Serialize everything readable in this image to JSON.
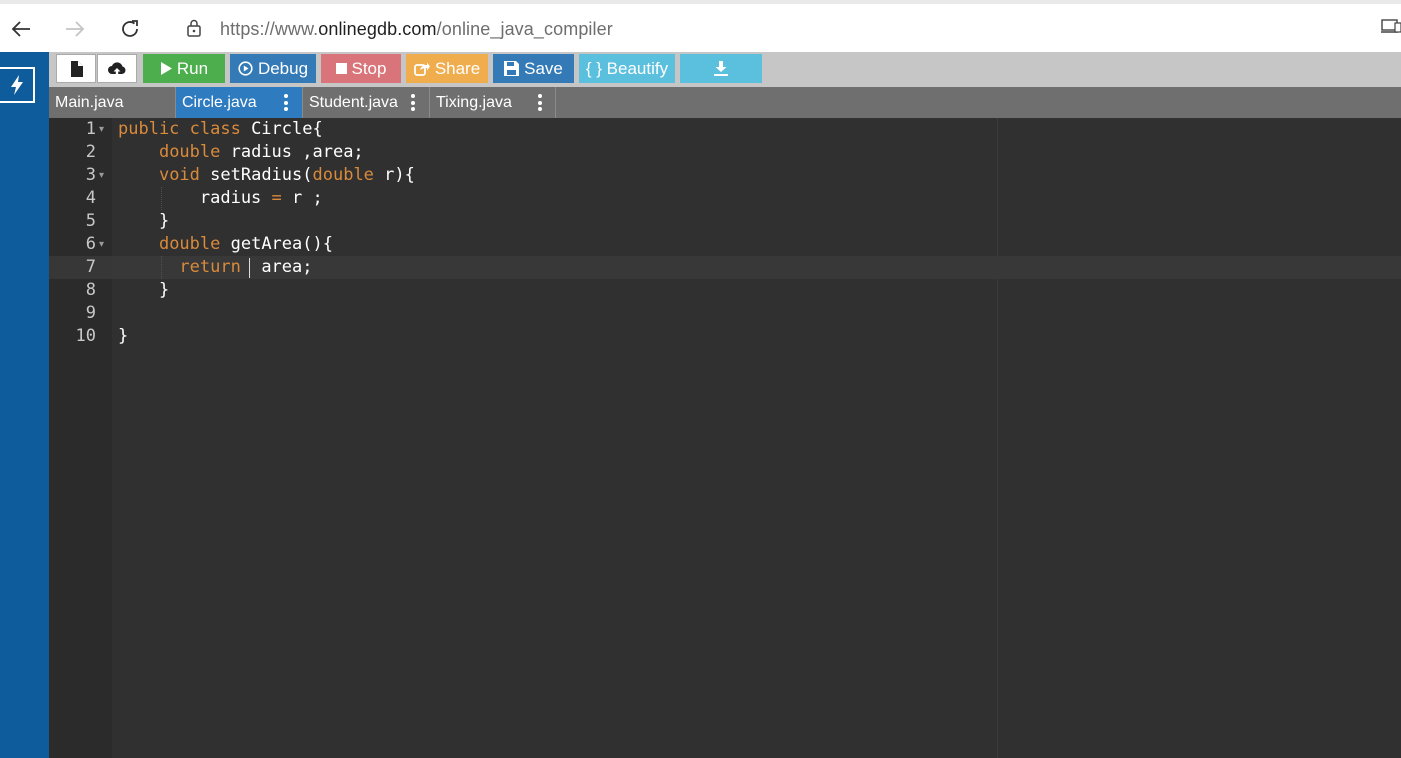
{
  "browser": {
    "url_scheme": "https://www.",
    "url_host": "onlinegdb.com",
    "url_path": "/online_java_compiler"
  },
  "toolbar": {
    "run_label": "Run",
    "debug_label": "Debug",
    "stop_label": "Stop",
    "share_label": "Share",
    "save_label": "Save",
    "beautify_label": "{ } Beautify"
  },
  "tabs": [
    {
      "label": "Main.java",
      "active": false
    },
    {
      "label": "Circle.java",
      "active": true
    },
    {
      "label": "Student.java",
      "active": false
    },
    {
      "label": "Tixing.java",
      "active": false
    }
  ],
  "editor": {
    "line_numbers": [
      "1",
      "2",
      "3",
      "4",
      "5",
      "6",
      "7",
      "8",
      "9",
      "10"
    ],
    "active_line": 7,
    "lines": [
      [
        {
          "t": "public class ",
          "k": "kw"
        },
        {
          "t": "Circle{",
          "k": "fn"
        }
      ],
      [
        {
          "t": "    "
        },
        {
          "t": "double",
          "k": "kw"
        },
        {
          "t": " radius ,area;"
        }
      ],
      [
        {
          "t": "    "
        },
        {
          "t": "void",
          "k": "kw"
        },
        {
          "t": " setRadius("
        },
        {
          "t": "double",
          "k": "kw"
        },
        {
          "t": " r){"
        }
      ],
      [
        {
          "t": "        radius "
        },
        {
          "t": "=",
          "k": "kw"
        },
        {
          "t": " r ;"
        }
      ],
      [
        {
          "t": "    }"
        }
      ],
      [
        {
          "t": "    "
        },
        {
          "t": "double",
          "k": "kw"
        },
        {
          "t": " getArea(){"
        }
      ],
      [
        {
          "t": "      "
        },
        {
          "t": "return",
          "k": "kw"
        },
        {
          "t": "  area;"
        }
      ],
      [
        {
          "t": "    }"
        }
      ],
      [
        {
          "t": ""
        }
      ],
      [
        {
          "t": "}"
        }
      ]
    ]
  },
  "colors": {
    "keyword": "#d98a3b",
    "sidebar": "#0e5c9b",
    "run": "#4cae4c",
    "debug": "#337ab7",
    "stop": "#d9757a",
    "share": "#f0ad4e",
    "save": "#337ab7",
    "beautify": "#5bc0de",
    "active_tab": "#2f7bbf"
  }
}
